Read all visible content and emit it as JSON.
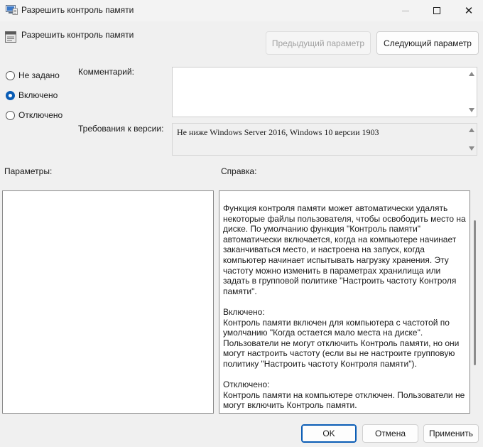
{
  "window": {
    "title": "Разрешить контроль памяти",
    "icons": {
      "app": "policy-app-icon",
      "minimize": "minimize-icon",
      "maximize": "maximize-icon",
      "close": "close-icon"
    }
  },
  "header": {
    "policy_title": "Разрешить контроль памяти",
    "prev_label": "Предыдущий параметр",
    "next_label": "Следующий параметр"
  },
  "state": {
    "options": [
      {
        "label": "Не задано",
        "checked": false
      },
      {
        "label": "Включено",
        "checked": true
      },
      {
        "label": "Отключено",
        "checked": false
      }
    ]
  },
  "comment": {
    "label": "Комментарий:",
    "value": ""
  },
  "version": {
    "label": "Требования к версии:",
    "value": "Не ниже Windows Server 2016, Windows 10 версии 1903"
  },
  "params": {
    "label": "Параметры:"
  },
  "help": {
    "label": "Справка:",
    "text": "Функция контроля памяти может автоматически удалять некоторые файлы пользователя, чтобы освободить место на диске. По умолчанию функция \"Контроль памяти\" автоматически включается, когда на компьютере начинает заканчиваться место, и настроена на запуск, когда компьютер начинает испытывать нагрузку хранения. Эту частоту можно изменить в параметрах хранилища или задать в групповой политике \"Настроить частоту Контроля памяти\".\n\nВключено:\nКонтроль памяти включен для компьютера с частотой по умолчанию \"Когда остается мало места на диске\". Пользователи не могут отключить Контроль памяти, но они могут настроить частоту (если вы не настроите групповую политику \"Настроить частоту Контроля памяти\").\n\nОтключено:\nКонтроль памяти на компьютере отключен. Пользователи не могут включить Контроль памяти."
  },
  "footer": {
    "ok_label": "OK",
    "cancel_label": "Отмена",
    "apply_label": "Применить"
  },
  "colors": {
    "accent": "#0a5cb5",
    "background": "#f0f0f0"
  }
}
